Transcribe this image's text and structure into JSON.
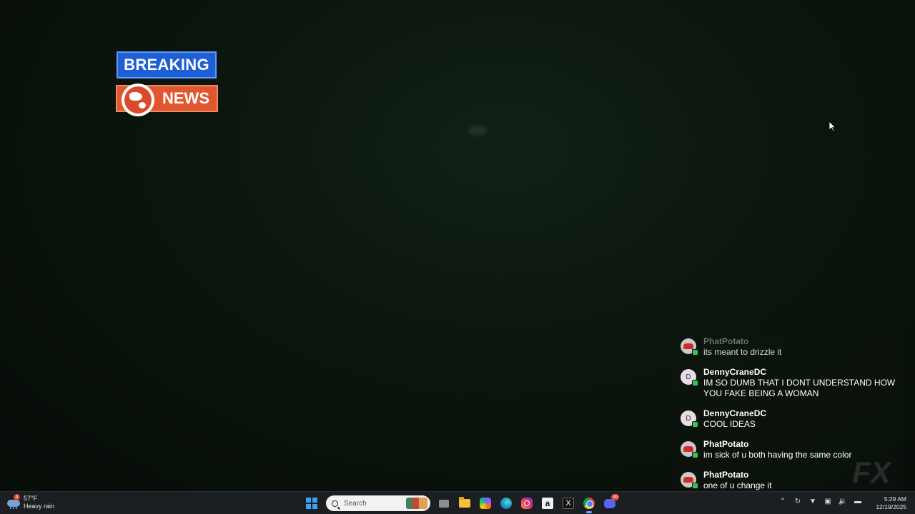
{
  "overlay": {
    "badge_top": "BREAKING",
    "badge_bottom": "NEWS"
  },
  "chat": {
    "messages": [
      {
        "user": "PhatPotato",
        "text": "its meant to drizzle it",
        "avatar": "potato-avatar",
        "faded": true
      },
      {
        "user": "DennyCraneDC",
        "text": "IM SO DUMB THAT I DONT UNDERSTAND HOW YOU FAKE BEING A WOMAN",
        "avatar": "D"
      },
      {
        "user": "DennyCraneDC",
        "text": "COOL IDEAS",
        "avatar": "D"
      },
      {
        "user": "PhatPotato",
        "text": "im sick of u both having the same color",
        "avatar": "potato-avatar"
      },
      {
        "user": "PhatPotato",
        "text": "one of u change it",
        "avatar": "potato-avatar"
      }
    ],
    "watermark": "FX"
  },
  "taskbar": {
    "weather": {
      "temp": "57°F",
      "condition": "Heavy rain",
      "badge": "4"
    },
    "search_placeholder": "Search",
    "discord_badge": "99",
    "clock": {
      "time": "5:29 AM",
      "date": "12/19/2025"
    },
    "icons": [
      "start-icon",
      "search-icon",
      "task-view-icon",
      "file-explorer-icon",
      "copilot-icon",
      "edge-icon",
      "instagram-icon",
      "amazon-icon",
      "x-icon",
      "chrome-icon",
      "discord-icon"
    ],
    "amazon_glyph": "a",
    "x_glyph": "X"
  },
  "colors": {
    "badge_blue": "#1f5fd6",
    "badge_orange": "#e0562e",
    "taskbar_bg": "#1c1f22"
  }
}
